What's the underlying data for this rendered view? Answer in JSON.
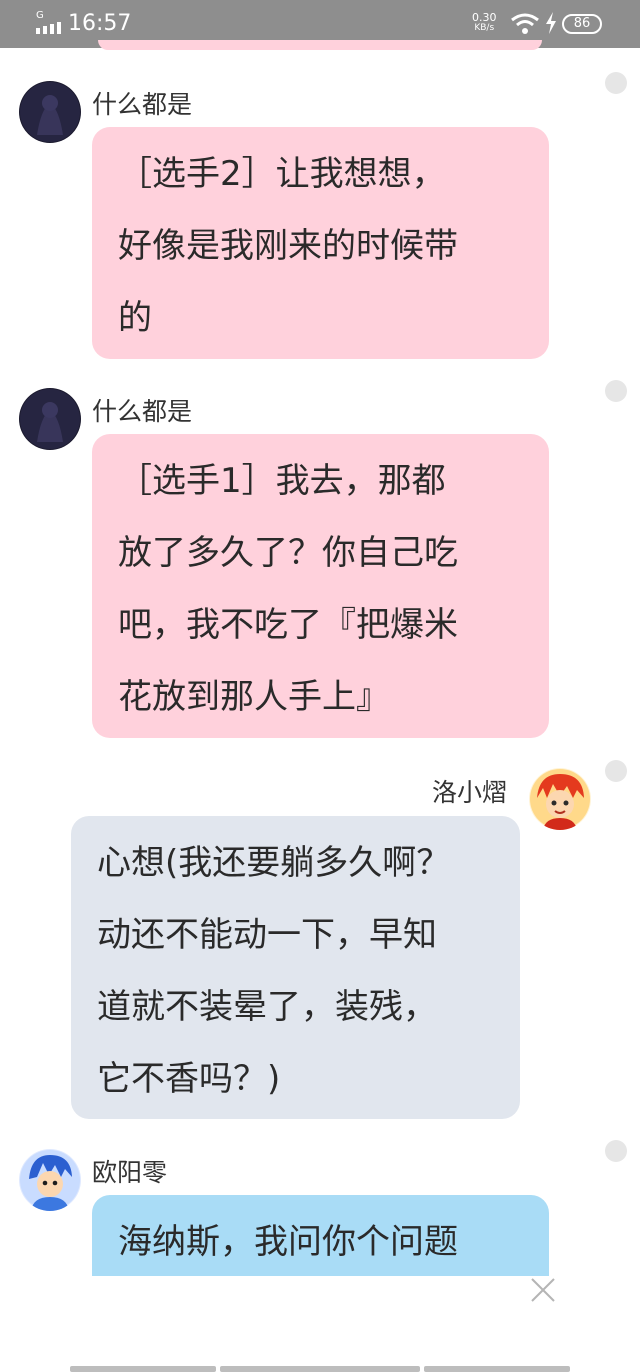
{
  "status_bar": {
    "network": "G",
    "time": "16:57",
    "speed_value": "0.30",
    "speed_unit": "KB/s",
    "battery": "86"
  },
  "messages": [
    {
      "sender": "什么都是",
      "side": "left",
      "bubble_color": "#ffd1dc",
      "avatar": "dark-avatar",
      "lines": [
        "［选手2］让我想想，",
        "好像是我刚来的时候带",
        "的"
      ]
    },
    {
      "sender": "什么都是",
      "side": "left",
      "bubble_color": "#ffd1dc",
      "avatar": "dark-avatar",
      "lines": [
        "［选手1］我去，那都",
        "放了多久了？你自己吃",
        "吧，我不吃了『把爆米",
        "花放到那人手上』"
      ]
    },
    {
      "sender": "洛小熠",
      "side": "right",
      "bubble_color": "#e1e6ee",
      "avatar": "red-hair-cartoon-avatar",
      "lines": [
        "心想(我还要躺多久啊？",
        "动还不能动一下，早知",
        "道就不装晕了，装残，",
        "它不香吗？)"
      ]
    },
    {
      "sender": "欧阳零",
      "side": "left",
      "bubble_color": "#a9dcf6",
      "avatar": "blue-hair-cartoon-avatar",
      "lines": [
        "海纳斯，我问你个问题"
      ]
    }
  ],
  "icons": {
    "close": "close-icon",
    "wifi": "wifi-icon",
    "charging": "charging-bolt-icon",
    "signal": "signal-icon"
  }
}
